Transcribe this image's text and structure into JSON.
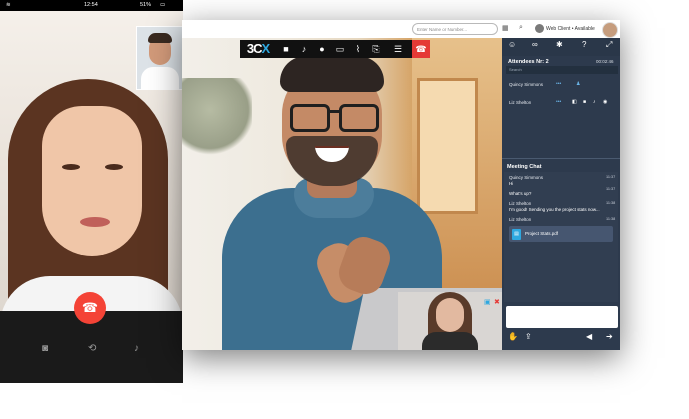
{
  "phone": {
    "status_time": "12:54",
    "battery": "51%",
    "icons": {
      "camera": "camera-icon",
      "flip_camera": "flip-camera-icon",
      "mic": "microphone-icon",
      "hangup": "hangup-icon"
    }
  },
  "desktop": {
    "search_placeholder": "Enter Name or Number...",
    "user_status": "Web Client • Available",
    "toolbar": {
      "logo_a": "3C",
      "logo_b": "X",
      "icons": [
        "video-camera-icon",
        "microphone-icon",
        "record-icon",
        "screen-share-icon",
        "attach-icon",
        "file-icon",
        "whiteboard-icon",
        "hangup-icon"
      ],
      "hangup_color": "#e53935"
    },
    "attendees": {
      "title": "Attendees Nr: 2",
      "duration": "00:02:46",
      "search_placeholder": "Search",
      "list": [
        {
          "name": "Quincy Simmons"
        },
        {
          "name": "Liz Shelton"
        }
      ]
    },
    "chat": {
      "title": "Meeting Chat",
      "messages": [
        {
          "name": "Quincy Simmons",
          "time": "11:37",
          "text": "Hi"
        },
        {
          "name": "",
          "time": "11:37",
          "text": "What's up?"
        },
        {
          "name": "Liz Shelton",
          "time": "11:38",
          "text": "I'm good! Sending you the project stats now..."
        },
        {
          "name": "Liz Shelton",
          "time": "11:38",
          "text": ""
        }
      ],
      "file_name": "Project Stats.pdf"
    },
    "accent": "#2ea8e0"
  }
}
